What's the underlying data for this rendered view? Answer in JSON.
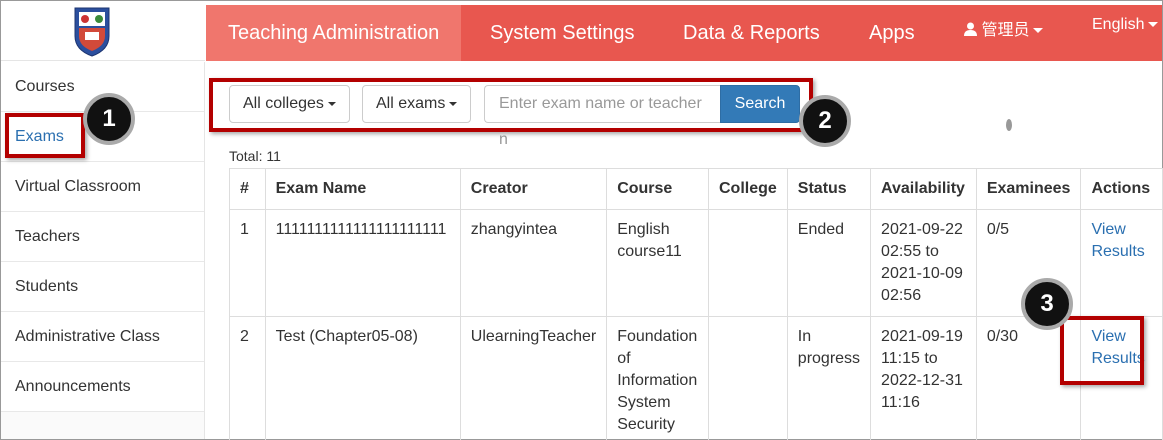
{
  "topnav": {
    "items": [
      "Teaching Administration",
      "System Settings",
      "Data & Reports",
      "Apps"
    ],
    "user": "管理员",
    "language": "English",
    "user_icon": "user-icon",
    "accent": "#e8574f"
  },
  "sidebar": {
    "items": [
      "Courses",
      "Exams",
      "Virtual Classroom",
      "Teachers",
      "Students",
      "Administrative Class",
      "Announcements"
    ],
    "active": "Exams"
  },
  "filters": {
    "college": "All colleges",
    "exam": "All exams",
    "search_placeholder": "Enter exam name or teacher n",
    "search_label": "Search"
  },
  "total_label": "Total: 11",
  "table": {
    "headers": [
      "#",
      "Exam Name",
      "Creator",
      "Course",
      "College",
      "Status",
      "Availability",
      "Examinees",
      "Actions"
    ],
    "rows": [
      {
        "num": "1",
        "name": "1111111111111111111111",
        "creator": "zhangyintea",
        "course": [
          "English",
          "course11"
        ],
        "college": "",
        "status": [
          "Ended"
        ],
        "availability": [
          "2021-09-22",
          "02:55 to",
          "2021-10-09",
          "02:56"
        ],
        "examinees": "0/5",
        "action": [
          "View",
          "Results"
        ]
      },
      {
        "num": "2",
        "name": "Test (Chapter05-08)",
        "creator": "UlearningTeacher",
        "course": [
          "Foundation",
          "of",
          "Information",
          "System",
          "Security"
        ],
        "college": "",
        "status": [
          "In",
          "progress"
        ],
        "availability": [
          "2021-09-19",
          "11:15 to",
          "2022-12-31",
          "11:16"
        ],
        "examinees": "0/30",
        "action": [
          "View",
          "Results"
        ]
      }
    ]
  },
  "annotations": [
    "1",
    "2",
    "3"
  ],
  "colors": {
    "highlight": "#b30000",
    "link": "#2a6fb0",
    "search_button": "#337ab7"
  }
}
